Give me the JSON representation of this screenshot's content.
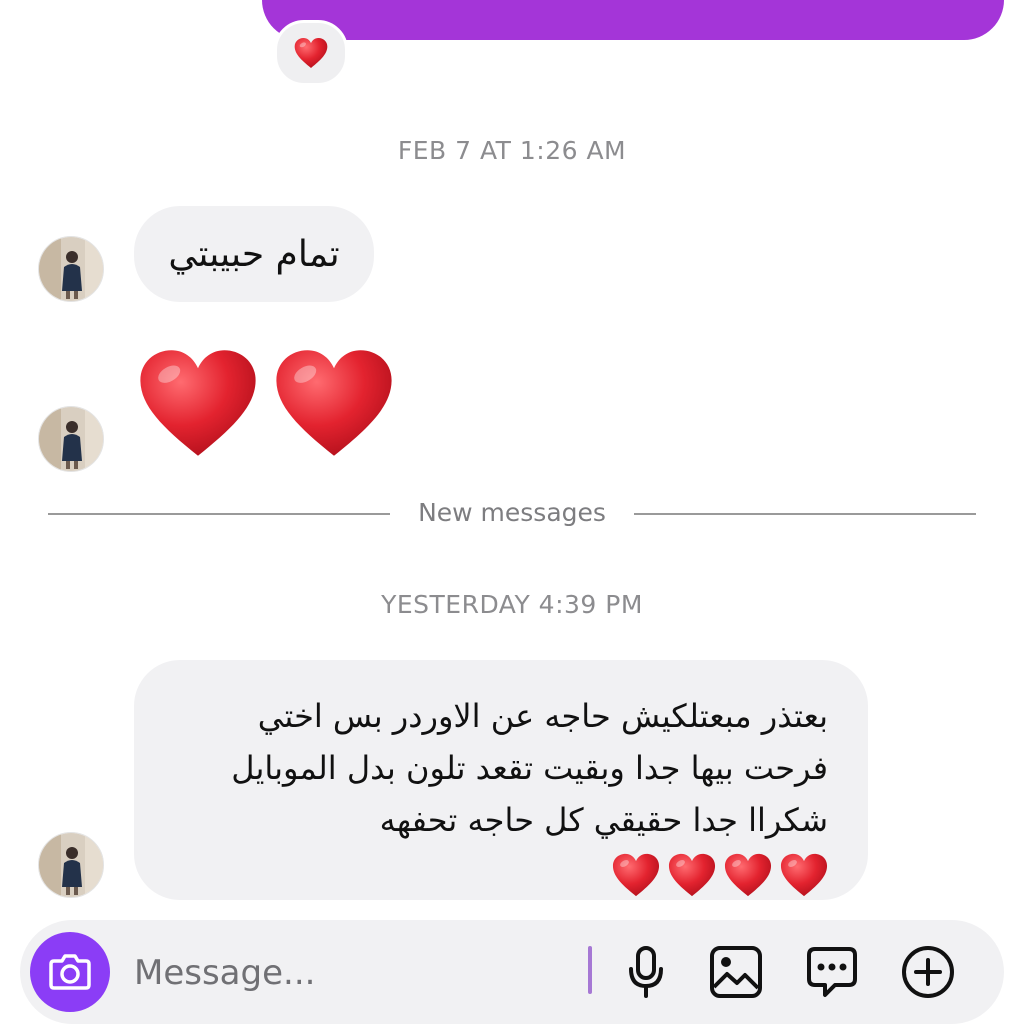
{
  "thread": {
    "timestamp_1": "FEB 7 AT 1:26 AM",
    "message_1": "تمام حبيبتي",
    "new_messages_label": "New messages",
    "timestamp_2": "YESTERDAY 4:39 PM",
    "message_3": "بعتذر مبعتلكيش حاجه عن الاوردر بس اختي فرحت بيها جدا وبقيت تقعد تلون بدل الموبايل شكراا جدا حقيقي كل حاجه تحفهه"
  },
  "composer": {
    "placeholder": "Message..."
  },
  "icons": {
    "reaction": "heart-icon",
    "camera": "camera-icon",
    "mic": "microphone-icon",
    "gallery": "image-icon",
    "sticker": "chat-bubble-dots-icon",
    "add": "plus-circle-icon"
  },
  "colors": {
    "sent_bubble": "#a435d8",
    "received_bubble": "#f1f1f3",
    "camera_button": "#8b3df6",
    "heart": "#e3232f"
  }
}
